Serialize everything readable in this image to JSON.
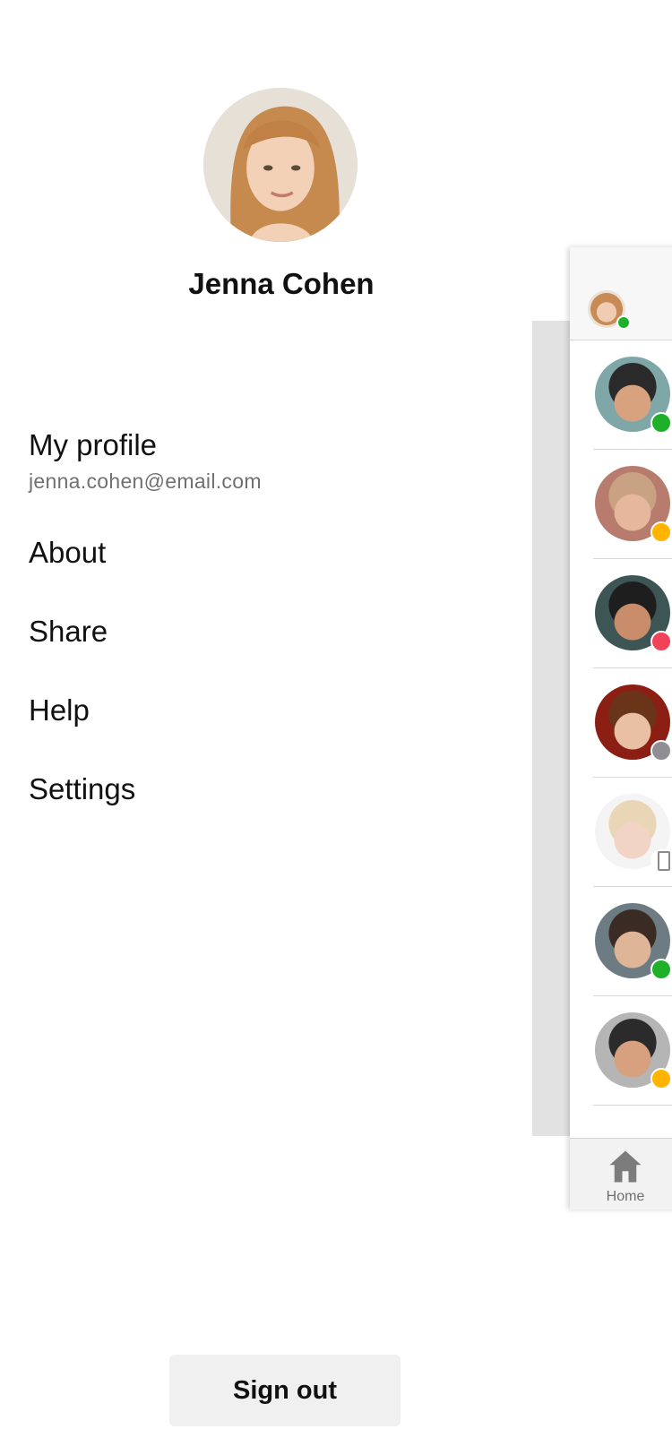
{
  "user": {
    "name": "Jenna Cohen",
    "presence": "available"
  },
  "menu": {
    "profile": {
      "label": "My profile",
      "email": "jenna.cohen@email.com"
    },
    "about": "About",
    "share": "Share",
    "help": "Help",
    "settings": "Settings"
  },
  "signout_label": "Sign out",
  "colors": {
    "available": "#1fb02a",
    "away": "#ffb400",
    "busy": "#f0435a",
    "offline": "#8e8e93"
  },
  "contacts": [
    {
      "status": "available",
      "skin": "#d9a27e",
      "hair": "#2a2a2a",
      "bg": "#7fa7a8"
    },
    {
      "status": "away",
      "skin": "#e6b79c",
      "hair": "#c9a284",
      "bg": "#b77c6d"
    },
    {
      "status": "busy",
      "skin": "#c98d6b",
      "hair": "#1e1e1e",
      "bg": "#3e5556"
    },
    {
      "status": "offline",
      "skin": "#eac0a4",
      "hair": "#6a3418",
      "bg": "#8c1f14"
    },
    {
      "status": "mobile",
      "skin": "#f1d4c4",
      "hair": "#e8d6b6",
      "bg": "#f4f4f4"
    },
    {
      "status": "available",
      "skin": "#dfb597",
      "hair": "#3a2c24",
      "bg": "#6d7c83"
    },
    {
      "status": "away",
      "skin": "#d7a07e",
      "hair": "#2b2b2b",
      "bg": "#b5b5b5"
    }
  ],
  "tab": {
    "icon": "home-icon",
    "label": "Home"
  }
}
